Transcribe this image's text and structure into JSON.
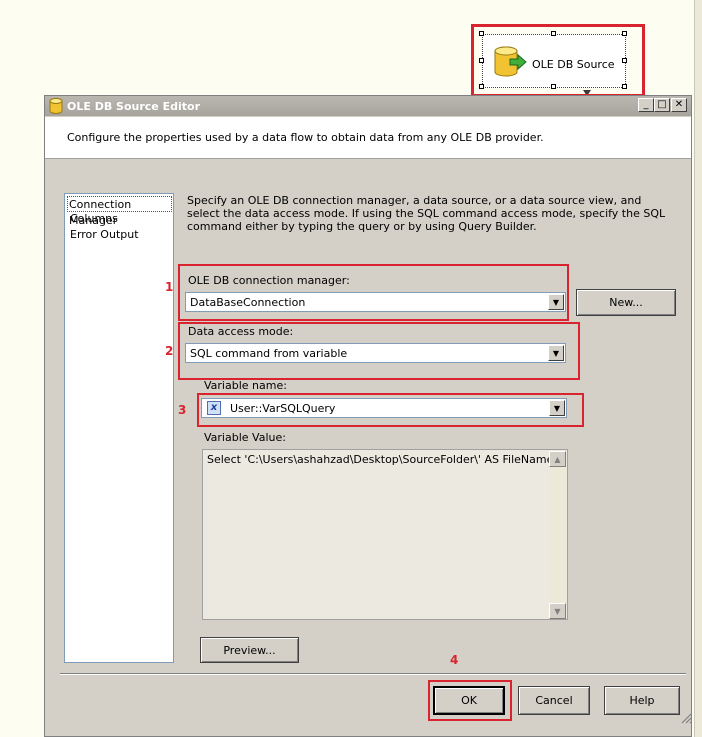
{
  "component": {
    "label": "OLE DB Source"
  },
  "dialog": {
    "title": "OLE DB Source Editor",
    "header_text": "Configure the properties used by a data flow to obtain data from any OLE DB provider.",
    "description": "Specify an OLE DB connection manager, a data source, or a data source view, and select the data access mode. If using the SQL command access mode, specify the SQL command either by typing the query or by using Query Builder."
  },
  "nav": {
    "items": [
      "Connection Manager",
      "Columns",
      "Error Output"
    ]
  },
  "fields": {
    "connection_manager_label": "OLE DB connection manager:",
    "connection_manager_value": "DataBaseConnection",
    "access_mode_label": "Data access mode:",
    "access_mode_value": "SQL command from variable",
    "variable_name_label": "Variable name:",
    "variable_name_value": "User::VarSQLQuery",
    "variable_value_label": "Variable Value:",
    "variable_value_text": "Select 'C:\\Users\\ashahzad\\Desktop\\SourceFolder\\' AS FileName"
  },
  "buttons": {
    "new": "New...",
    "preview": "Preview...",
    "ok": "OK",
    "cancel": "Cancel",
    "help": "Help"
  },
  "annotations": {
    "n1": "1",
    "n2": "2",
    "n3": "3",
    "n4": "4"
  },
  "colors": {
    "highlight": "#d9242f",
    "dialog_bg": "#d4d0c8",
    "canvas_bg": "#fdfdf1"
  },
  "icons": {
    "component": "database-arrow-icon",
    "variable": "variable-x-icon"
  }
}
